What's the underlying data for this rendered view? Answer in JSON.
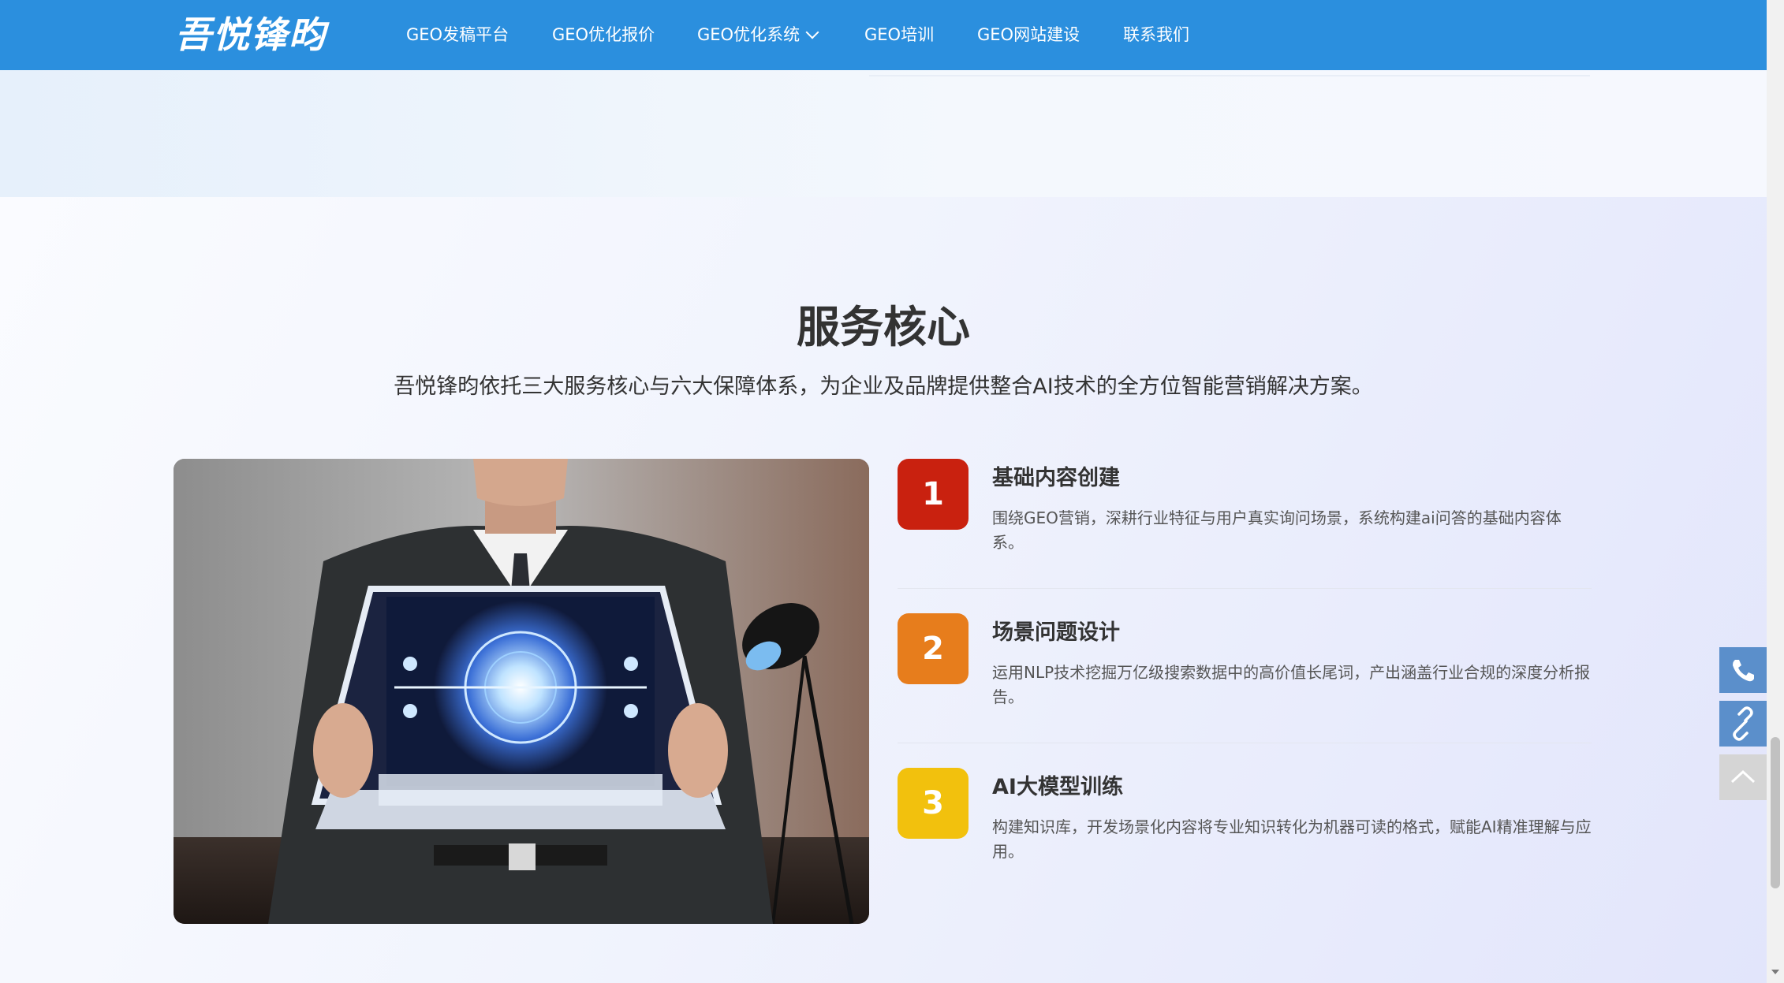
{
  "nav": {
    "logo": "吾悦锋昀",
    "items": [
      {
        "label": "GEO发稿平台"
      },
      {
        "label": "GEO优化报价"
      },
      {
        "label": "GEO优化系统"
      },
      {
        "label": "GEO培训"
      },
      {
        "label": "GEO网站建设"
      },
      {
        "label": "联系我们"
      }
    ]
  },
  "section": {
    "title": "服务核心",
    "subtitle": "吾悦锋昀依托三大服务核心与六大保障体系，为企业及品牌提供整合AI技术的全方位智能营销解决方案。"
  },
  "features": [
    {
      "num": "1",
      "color": "#c9210f",
      "title": "基础内容创建",
      "desc": "围绕GEO营销，深耕行业特征与用户真实询问场景，系统构建ai问答的基础内容体系。"
    },
    {
      "num": "2",
      "color": "#e77d1c",
      "title": "场景问题设计",
      "desc": "运用NLP技术挖掘万亿级搜索数据中的高价值长尾词，产出涵盖行业合规的深度分析报告。"
    },
    {
      "num": "3",
      "color": "#f2c10d",
      "title": "AI大模型训练",
      "desc": "构建知识库，开发场景化内容将专业知识转化为机器可读的格式，赋能AI精准理解与应用。"
    }
  ],
  "colors": {
    "nav_bg": "#2b8fde",
    "side_btn": "#5b8fcb",
    "side_top_btn": "#d5d5d5"
  },
  "side_icons": [
    "phone-icon",
    "link-icon",
    "back-to-top-icon"
  ]
}
